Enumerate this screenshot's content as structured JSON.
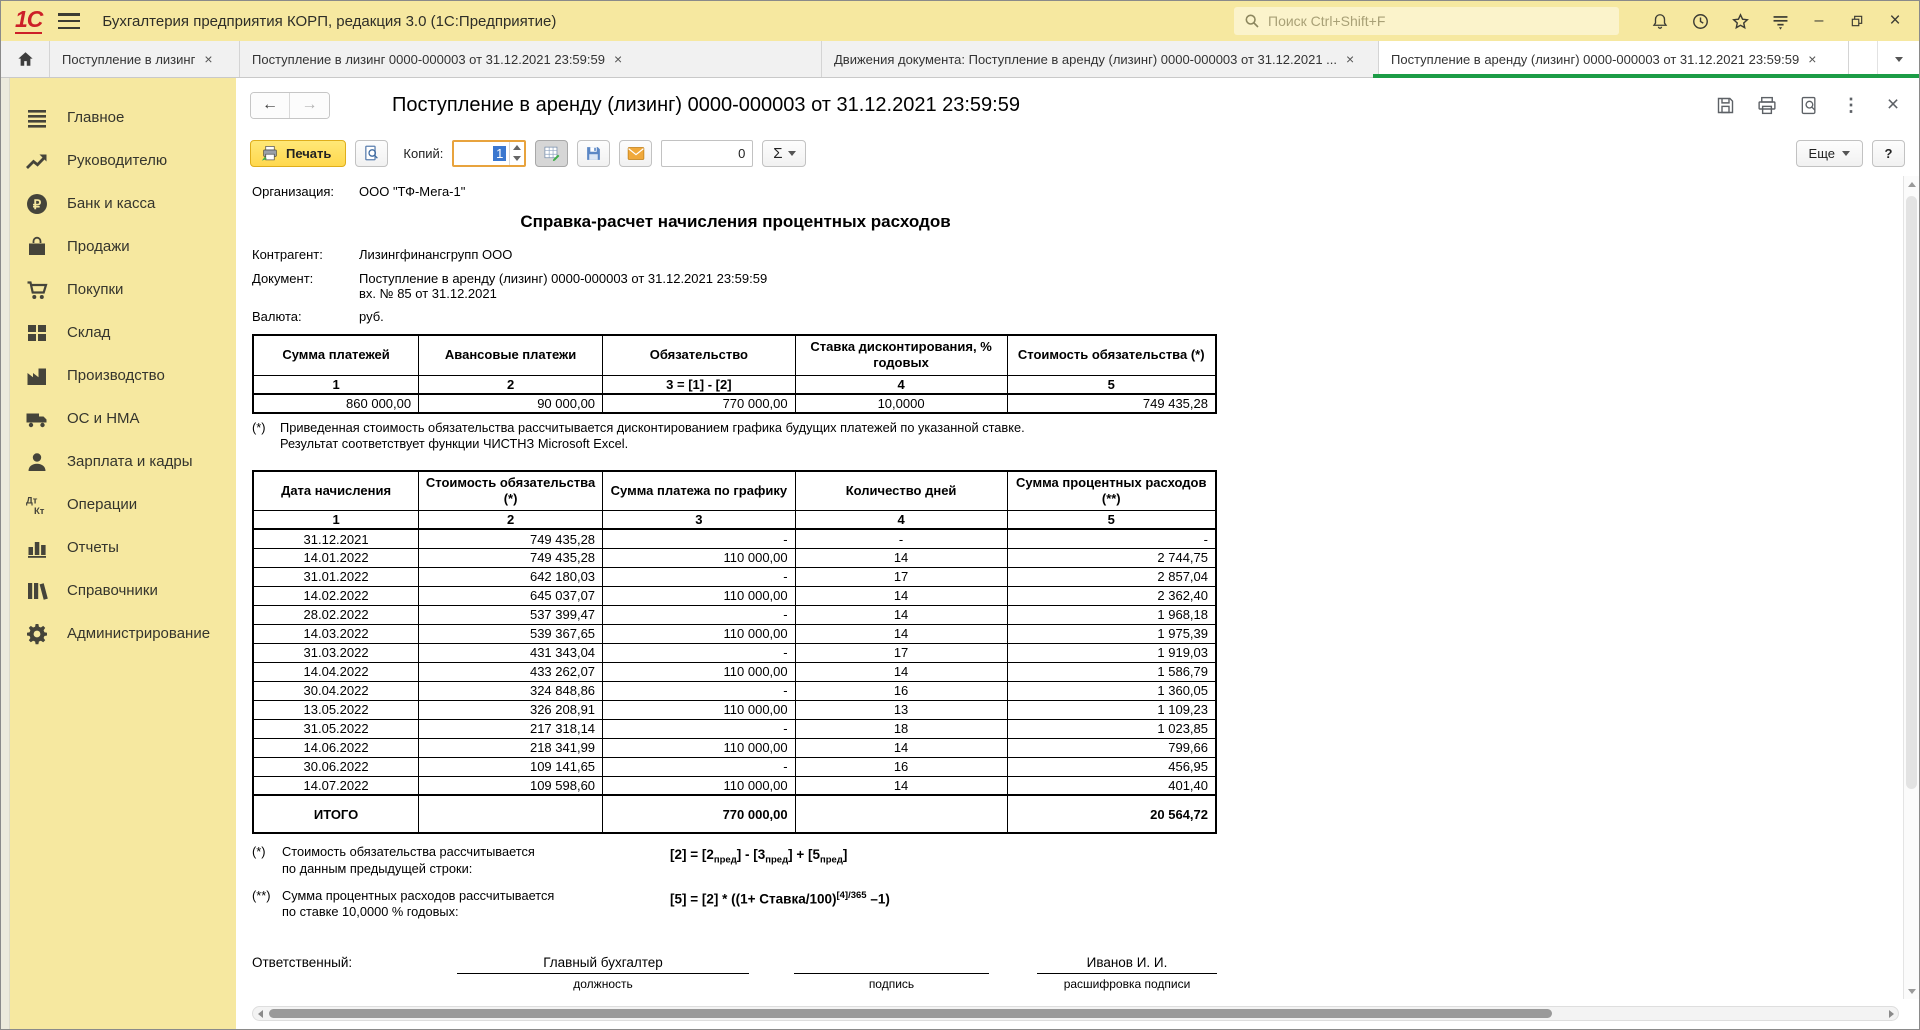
{
  "window": {
    "title": "Бухгалтерия предприятия КОРП, редакция 3.0  (1С:Предприятие)",
    "logo": "1С",
    "search_placeholder": "Поиск Ctrl+Shift+F"
  },
  "tabs": [
    {
      "label": "Поступление в лизинг",
      "active": false
    },
    {
      "label": "Поступление в лизинг 0000-000003 от 31.12.2021 23:59:59",
      "active": false
    },
    {
      "label": "Движения документа: Поступление в аренду (лизинг) 0000-000003 от 31.12.2021 ...",
      "active": false
    },
    {
      "label": "Поступление в аренду (лизинг) 0000-000003 от 31.12.2021 23:59:59",
      "active": true
    }
  ],
  "sidebar": {
    "items": [
      {
        "icon": "menu-icon",
        "label": "Главное"
      },
      {
        "icon": "trend-icon",
        "label": "Руководителю"
      },
      {
        "icon": "ruble-icon",
        "label": "Банк и касса"
      },
      {
        "icon": "bag-icon",
        "label": "Продажи"
      },
      {
        "icon": "cart-icon",
        "label": "Покупки"
      },
      {
        "icon": "warehouse-icon",
        "label": "Склад"
      },
      {
        "icon": "factory-icon",
        "label": "Производство"
      },
      {
        "icon": "truck-icon",
        "label": "ОС и НМА"
      },
      {
        "icon": "person-icon",
        "label": "Зарплата и кадры"
      },
      {
        "icon": "dtkt-icon",
        "label": "Операции"
      },
      {
        "icon": "chart-icon",
        "label": "Отчеты"
      },
      {
        "icon": "books-icon",
        "label": "Справочники"
      },
      {
        "icon": "gear-icon",
        "label": "Администрирование"
      }
    ]
  },
  "form": {
    "title": "Поступление в аренду (лизинг) 0000-000003 от 31.12.2021 23:59:59",
    "toolbar": {
      "print_label": "Печать",
      "copies_label": "Копий:",
      "copies_value": "1",
      "counter_value": "0",
      "sum_label": "Σ",
      "more_label": "Еще",
      "help_label": "?"
    }
  },
  "document": {
    "org_label": "Организация:",
    "org_value": "ООО \"ТФ-Мега-1\"",
    "title": "Справка-расчет начисления процентных расходов",
    "contractor_label": "Контрагент:",
    "contractor_value": "Лизингфинансгрупп ООО",
    "doc_label": "Документ:",
    "doc_value_line1": "Поступление в аренду (лизинг) 0000-000003 от 31.12.2021 23:59:59",
    "doc_value_line2": "вх. № 85 от 31.12.2021",
    "currency_label": "Валюта:",
    "currency_value": "руб.",
    "table1": {
      "headers": [
        "Сумма платежей",
        "Авансовые платежи",
        "Обязательство",
        "Ставка дисконтирования, % годовых",
        "Стоимость обязательства (*)"
      ],
      "numbers": [
        "1",
        "2",
        "3 = [1] - [2]",
        "4",
        "5"
      ],
      "row": [
        "860 000,00",
        "90 000,00",
        "770 000,00",
        "10,0000",
        "749 435,28"
      ]
    },
    "footnote1": {
      "marker": "(*)",
      "lines": [
        "Приведенная стоимость обязательства рассчитывается дисконтированием графика будущих платежей по указанной ставке.",
        "Результат соответствует функции ЧИСТНЗ Microsoft Excel."
      ]
    },
    "table2": {
      "headers": [
        "Дата начисления",
        "Стоимость обязательства (*)",
        "Сумма платежа по графику",
        "Количество дней",
        "Сумма процентных расходов (**)"
      ],
      "numbers": [
        "1",
        "2",
        "3",
        "4",
        "5"
      ],
      "rows": [
        [
          "31.12.2021",
          "749 435,28",
          "-",
          "-",
          "-"
        ],
        [
          "14.01.2022",
          "749 435,28",
          "110 000,00",
          "14",
          "2 744,75"
        ],
        [
          "31.01.2022",
          "642 180,03",
          "-",
          "17",
          "2 857,04"
        ],
        [
          "14.02.2022",
          "645 037,07",
          "110 000,00",
          "14",
          "2 362,40"
        ],
        [
          "28.02.2022",
          "537 399,47",
          "-",
          "14",
          "1 968,18"
        ],
        [
          "14.03.2022",
          "539 367,65",
          "110 000,00",
          "14",
          "1 975,39"
        ],
        [
          "31.03.2022",
          "431 343,04",
          "-",
          "17",
          "1 919,03"
        ],
        [
          "14.04.2022",
          "433 262,07",
          "110 000,00",
          "14",
          "1 586,79"
        ],
        [
          "30.04.2022",
          "324 848,86",
          "-",
          "16",
          "1 360,05"
        ],
        [
          "13.05.2022",
          "326 208,91",
          "110 000,00",
          "13",
          "1 109,23"
        ],
        [
          "31.05.2022",
          "217 318,14",
          "-",
          "18",
          "1 023,85"
        ],
        [
          "14.06.2022",
          "218 341,99",
          "110 000,00",
          "14",
          "799,66"
        ],
        [
          "30.06.2022",
          "109 141,65",
          "-",
          "16",
          "456,95"
        ],
        [
          "14.07.2022",
          "109 598,60",
          "110 000,00",
          "14",
          "401,40"
        ]
      ],
      "total": [
        "ИТОГО",
        "",
        "770 000,00",
        "",
        "20 564,72"
      ]
    },
    "footnote2": [
      {
        "marker": "(*)",
        "lines": [
          "Стоимость обязательства рассчитывается",
          "по данным предыдущей строки:"
        ],
        "formula": [
          {
            "t": "[2] = [2"
          },
          {
            "sub": "пред"
          },
          {
            "t": "] - [3"
          },
          {
            "sub": "пред"
          },
          {
            "t": "] + [5"
          },
          {
            "sub": "пред"
          },
          {
            "t": "]"
          }
        ]
      },
      {
        "marker": "(**)",
        "lines": [
          "Сумма процентных расходов рассчитывается",
          "по ставке 10,0000 % годовых:"
        ],
        "formula": [
          {
            "t": "[5] = [2] * ((1+ Ставка/100)"
          },
          {
            "sup": "[4]/365"
          },
          {
            "t": " –1)"
          }
        ]
      }
    ],
    "signature": {
      "label": "Ответственный:",
      "blocks": [
        {
          "value": "Главный бухгалтер",
          "caption": "должность"
        },
        {
          "value": "",
          "caption": "подпись"
        },
        {
          "value": "Иванов И. И.",
          "caption": "расшифровка подписи"
        }
      ]
    }
  }
}
